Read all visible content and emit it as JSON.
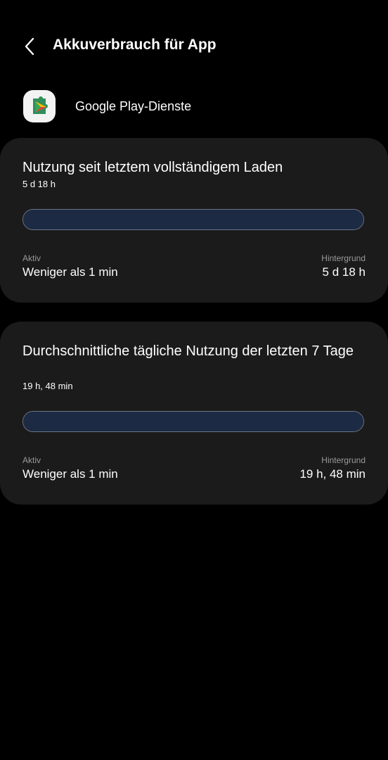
{
  "header": {
    "back_icon": "chevron-left-icon",
    "title": "Akkuverbrauch für App"
  },
  "app": {
    "icon": "google-play-services-icon",
    "name": "Google Play-Dienste"
  },
  "cards": [
    {
      "title": "Nutzung seit letztem vollständigem Laden",
      "subtitle": "5 d 18 h",
      "bar_fill_fraction": 1.0,
      "active_label": "Aktiv",
      "active_value": "Weniger als 1 min",
      "background_label": "Hintergrund",
      "background_value": "5 d 18 h"
    },
    {
      "title": "Durchschnittliche tägliche Nutzung der letzten 7 Tage",
      "subtitle": "19 h, 48 min",
      "bar_fill_fraction": 1.0,
      "active_label": "Aktiv",
      "active_value": "Weniger als 1 min",
      "background_label": "Hintergrund",
      "background_value": "19 h, 48 min"
    }
  ],
  "colors": {
    "background": "#000000",
    "card": "#1b1b1b",
    "bar_fill": "#1c2a43",
    "bar_border": "#6c7587",
    "label": "#9a9a9a"
  }
}
